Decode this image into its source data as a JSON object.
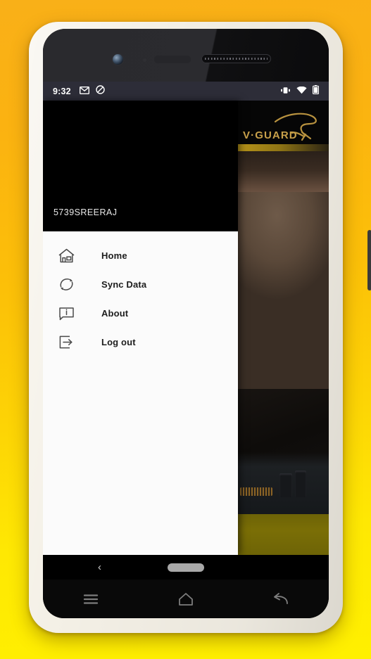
{
  "device": {
    "name": "android-phone-mockup",
    "backdrop_color_top": "#f9b018",
    "backdrop_color_bottom": "#fff000",
    "bezel_color": "#f4f0e6",
    "screen_color": "#000000"
  },
  "status_bar": {
    "time": "9:32",
    "background": "#2d2d38",
    "left_icons": [
      {
        "name": "gmail-icon",
        "glyph": "envelope"
      },
      {
        "name": "do-not-disturb-icon",
        "glyph": "block-circle"
      }
    ],
    "right_icons": [
      {
        "name": "vibrate-icon",
        "glyph": "vibrate"
      },
      {
        "name": "wifi-icon",
        "glyph": "wifi"
      },
      {
        "name": "battery-icon",
        "glyph": "battery"
      }
    ]
  },
  "brand": {
    "name": "V-GUARD",
    "word_v": "V",
    "word_guard": "GUARD",
    "separator": "·",
    "color": "#c8a04a"
  },
  "drawer": {
    "username": "5739SREERAJ",
    "header_background": "#000000",
    "menu_background": "#fbfbfb",
    "items": [
      {
        "label": "Home",
        "icon": "home-icon",
        "name": "drawer-item-home"
      },
      {
        "label": "Sync Data",
        "icon": "sync-icon",
        "name": "drawer-item-sync-data"
      },
      {
        "label": "About",
        "icon": "info-icon",
        "name": "drawer-item-about"
      },
      {
        "label": "Log out",
        "icon": "logout-icon",
        "name": "drawer-item-log-out"
      }
    ]
  },
  "background_photo": {
    "description": "technician working on a circuit board",
    "accent_yellow": "#6e6406"
  },
  "soft_nav": {
    "back_glyph": "‹",
    "home_indicator": "pill"
  },
  "device_nav": {
    "buttons": [
      {
        "name": "recents-button",
        "icon": "menu-icon"
      },
      {
        "name": "home-button",
        "icon": "home-outline-icon"
      },
      {
        "name": "back-button",
        "icon": "back-arrow-icon"
      }
    ]
  }
}
